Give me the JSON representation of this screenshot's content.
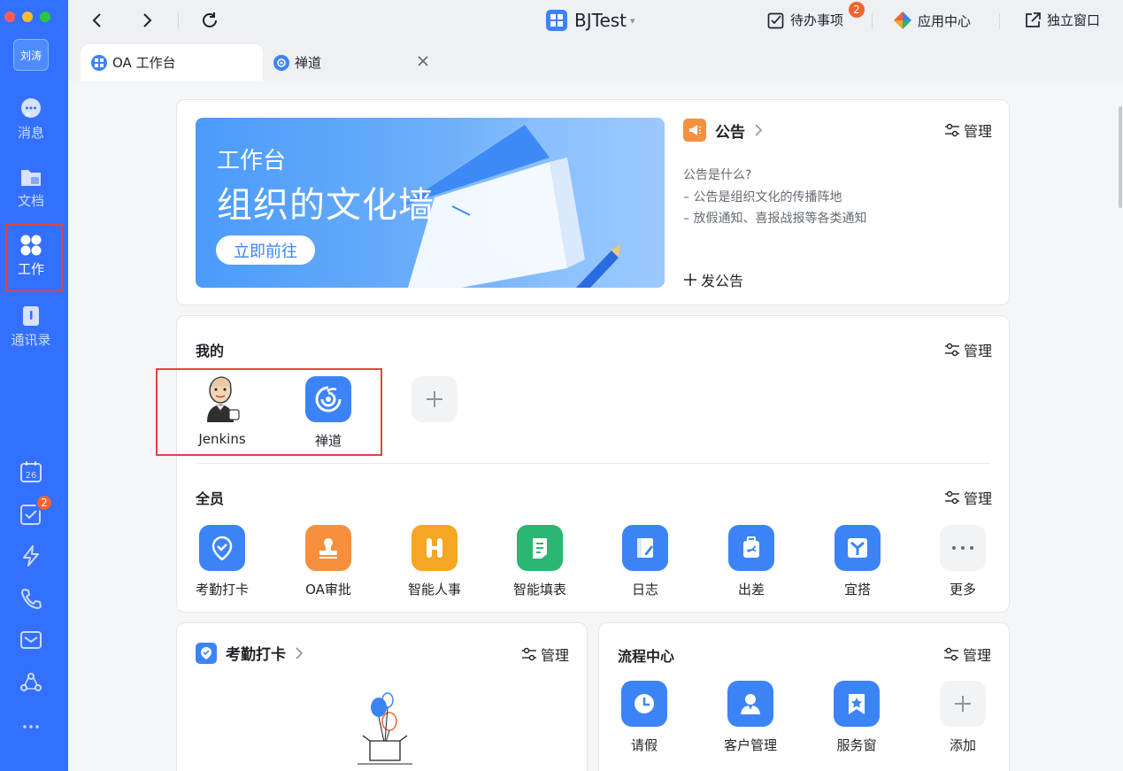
{
  "sidebar": {
    "user_name": "刘涛",
    "items": [
      {
        "label": "消息"
      },
      {
        "label": "文档"
      },
      {
        "label": "工作"
      },
      {
        "label": "通讯录"
      }
    ],
    "todo_badge": "2"
  },
  "titlebar": {
    "app_name": "BJTest",
    "todo_label": "待办事项",
    "todo_badge": "2",
    "app_center_label": "应用中心",
    "standalone_label": "独立窗口"
  },
  "tabs": [
    {
      "label": "OA 工作台"
    },
    {
      "label": "禅道"
    }
  ],
  "banner": {
    "line1": "工作台",
    "line2": "组织的文化墙",
    "button": "立即前往"
  },
  "announcement": {
    "title": "公告",
    "manage": "管理",
    "lines": [
      "公告是什么?",
      "– 公告是组织文化的传播阵地",
      "– 放假通知、喜报战报等各类通知"
    ],
    "post": "发公告"
  },
  "mine": {
    "title": "我的",
    "manage": "管理",
    "apps": [
      {
        "label": "Jenkins"
      },
      {
        "label": "禅道"
      }
    ]
  },
  "all": {
    "title": "全员",
    "manage": "管理",
    "apps": [
      {
        "label": "考勤打卡",
        "icon": "checkin-icon"
      },
      {
        "label": "OA审批",
        "icon": "stamp-icon"
      },
      {
        "label": "智能人事",
        "icon": "hr-icon"
      },
      {
        "label": "智能填表",
        "icon": "form-icon"
      },
      {
        "label": "日志",
        "icon": "log-icon"
      },
      {
        "label": "出差",
        "icon": "travel-icon"
      },
      {
        "label": "宜搭",
        "icon": "yida-icon"
      },
      {
        "label": "更多",
        "icon": "more-icon"
      }
    ]
  },
  "attendance": {
    "title": "考勤打卡",
    "manage": "管理"
  },
  "process": {
    "title": "流程中心",
    "manage": "管理",
    "apps": [
      {
        "label": "请假"
      },
      {
        "label": "客户管理"
      },
      {
        "label": "服务窗"
      },
      {
        "label": "添加"
      }
    ]
  },
  "colors": {
    "sidebar": "#3370ff",
    "accent": "#3c84f6",
    "badge": "#f5622e",
    "highlight": "#e0443e"
  }
}
